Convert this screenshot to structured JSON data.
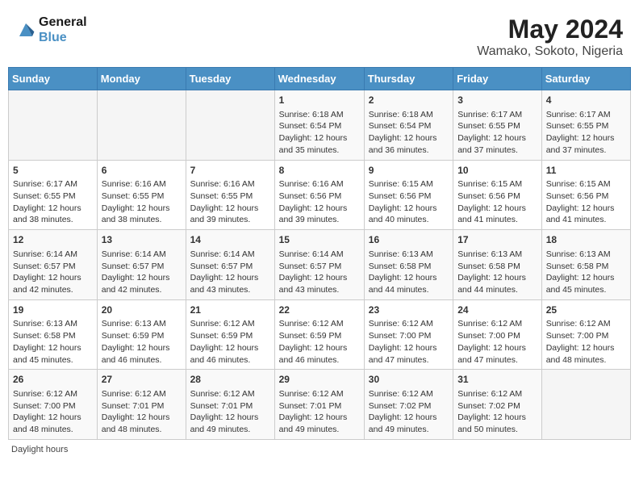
{
  "header": {
    "logo_line1": "General",
    "logo_line2": "Blue",
    "title": "May 2024",
    "subtitle": "Wamako, Sokoto, Nigeria"
  },
  "days_of_week": [
    "Sunday",
    "Monday",
    "Tuesday",
    "Wednesday",
    "Thursday",
    "Friday",
    "Saturday"
  ],
  "weeks": [
    [
      {
        "day": "",
        "sunrise": "",
        "sunset": "",
        "daylight": ""
      },
      {
        "day": "",
        "sunrise": "",
        "sunset": "",
        "daylight": ""
      },
      {
        "day": "",
        "sunrise": "",
        "sunset": "",
        "daylight": ""
      },
      {
        "day": "1",
        "sunrise": "Sunrise: 6:18 AM",
        "sunset": "Sunset: 6:54 PM",
        "daylight": "Daylight: 12 hours and 35 minutes."
      },
      {
        "day": "2",
        "sunrise": "Sunrise: 6:18 AM",
        "sunset": "Sunset: 6:54 PM",
        "daylight": "Daylight: 12 hours and 36 minutes."
      },
      {
        "day": "3",
        "sunrise": "Sunrise: 6:17 AM",
        "sunset": "Sunset: 6:55 PM",
        "daylight": "Daylight: 12 hours and 37 minutes."
      },
      {
        "day": "4",
        "sunrise": "Sunrise: 6:17 AM",
        "sunset": "Sunset: 6:55 PM",
        "daylight": "Daylight: 12 hours and 37 minutes."
      }
    ],
    [
      {
        "day": "5",
        "sunrise": "Sunrise: 6:17 AM",
        "sunset": "Sunset: 6:55 PM",
        "daylight": "Daylight: 12 hours and 38 minutes."
      },
      {
        "day": "6",
        "sunrise": "Sunrise: 6:16 AM",
        "sunset": "Sunset: 6:55 PM",
        "daylight": "Daylight: 12 hours and 38 minutes."
      },
      {
        "day": "7",
        "sunrise": "Sunrise: 6:16 AM",
        "sunset": "Sunset: 6:55 PM",
        "daylight": "Daylight: 12 hours and 39 minutes."
      },
      {
        "day": "8",
        "sunrise": "Sunrise: 6:16 AM",
        "sunset": "Sunset: 6:56 PM",
        "daylight": "Daylight: 12 hours and 39 minutes."
      },
      {
        "day": "9",
        "sunrise": "Sunrise: 6:15 AM",
        "sunset": "Sunset: 6:56 PM",
        "daylight": "Daylight: 12 hours and 40 minutes."
      },
      {
        "day": "10",
        "sunrise": "Sunrise: 6:15 AM",
        "sunset": "Sunset: 6:56 PM",
        "daylight": "Daylight: 12 hours and 41 minutes."
      },
      {
        "day": "11",
        "sunrise": "Sunrise: 6:15 AM",
        "sunset": "Sunset: 6:56 PM",
        "daylight": "Daylight: 12 hours and 41 minutes."
      }
    ],
    [
      {
        "day": "12",
        "sunrise": "Sunrise: 6:14 AM",
        "sunset": "Sunset: 6:57 PM",
        "daylight": "Daylight: 12 hours and 42 minutes."
      },
      {
        "day": "13",
        "sunrise": "Sunrise: 6:14 AM",
        "sunset": "Sunset: 6:57 PM",
        "daylight": "Daylight: 12 hours and 42 minutes."
      },
      {
        "day": "14",
        "sunrise": "Sunrise: 6:14 AM",
        "sunset": "Sunset: 6:57 PM",
        "daylight": "Daylight: 12 hours and 43 minutes."
      },
      {
        "day": "15",
        "sunrise": "Sunrise: 6:14 AM",
        "sunset": "Sunset: 6:57 PM",
        "daylight": "Daylight: 12 hours and 43 minutes."
      },
      {
        "day": "16",
        "sunrise": "Sunrise: 6:13 AM",
        "sunset": "Sunset: 6:58 PM",
        "daylight": "Daylight: 12 hours and 44 minutes."
      },
      {
        "day": "17",
        "sunrise": "Sunrise: 6:13 AM",
        "sunset": "Sunset: 6:58 PM",
        "daylight": "Daylight: 12 hours and 44 minutes."
      },
      {
        "day": "18",
        "sunrise": "Sunrise: 6:13 AM",
        "sunset": "Sunset: 6:58 PM",
        "daylight": "Daylight: 12 hours and 45 minutes."
      }
    ],
    [
      {
        "day": "19",
        "sunrise": "Sunrise: 6:13 AM",
        "sunset": "Sunset: 6:58 PM",
        "daylight": "Daylight: 12 hours and 45 minutes."
      },
      {
        "day": "20",
        "sunrise": "Sunrise: 6:13 AM",
        "sunset": "Sunset: 6:59 PM",
        "daylight": "Daylight: 12 hours and 46 minutes."
      },
      {
        "day": "21",
        "sunrise": "Sunrise: 6:12 AM",
        "sunset": "Sunset: 6:59 PM",
        "daylight": "Daylight: 12 hours and 46 minutes."
      },
      {
        "day": "22",
        "sunrise": "Sunrise: 6:12 AM",
        "sunset": "Sunset: 6:59 PM",
        "daylight": "Daylight: 12 hours and 46 minutes."
      },
      {
        "day": "23",
        "sunrise": "Sunrise: 6:12 AM",
        "sunset": "Sunset: 7:00 PM",
        "daylight": "Daylight: 12 hours and 47 minutes."
      },
      {
        "day": "24",
        "sunrise": "Sunrise: 6:12 AM",
        "sunset": "Sunset: 7:00 PM",
        "daylight": "Daylight: 12 hours and 47 minutes."
      },
      {
        "day": "25",
        "sunrise": "Sunrise: 6:12 AM",
        "sunset": "Sunset: 7:00 PM",
        "daylight": "Daylight: 12 hours and 48 minutes."
      }
    ],
    [
      {
        "day": "26",
        "sunrise": "Sunrise: 6:12 AM",
        "sunset": "Sunset: 7:00 PM",
        "daylight": "Daylight: 12 hours and 48 minutes."
      },
      {
        "day": "27",
        "sunrise": "Sunrise: 6:12 AM",
        "sunset": "Sunset: 7:01 PM",
        "daylight": "Daylight: 12 hours and 48 minutes."
      },
      {
        "day": "28",
        "sunrise": "Sunrise: 6:12 AM",
        "sunset": "Sunset: 7:01 PM",
        "daylight": "Daylight: 12 hours and 49 minutes."
      },
      {
        "day": "29",
        "sunrise": "Sunrise: 6:12 AM",
        "sunset": "Sunset: 7:01 PM",
        "daylight": "Daylight: 12 hours and 49 minutes."
      },
      {
        "day": "30",
        "sunrise": "Sunrise: 6:12 AM",
        "sunset": "Sunset: 7:02 PM",
        "daylight": "Daylight: 12 hours and 49 minutes."
      },
      {
        "day": "31",
        "sunrise": "Sunrise: 6:12 AM",
        "sunset": "Sunset: 7:02 PM",
        "daylight": "Daylight: 12 hours and 50 minutes."
      },
      {
        "day": "",
        "sunrise": "",
        "sunset": "",
        "daylight": ""
      }
    ]
  ],
  "footer": {
    "text": "Daylight hours"
  },
  "colors": {
    "header_bg": "#4a90c4",
    "accent": "#4a90c4"
  }
}
